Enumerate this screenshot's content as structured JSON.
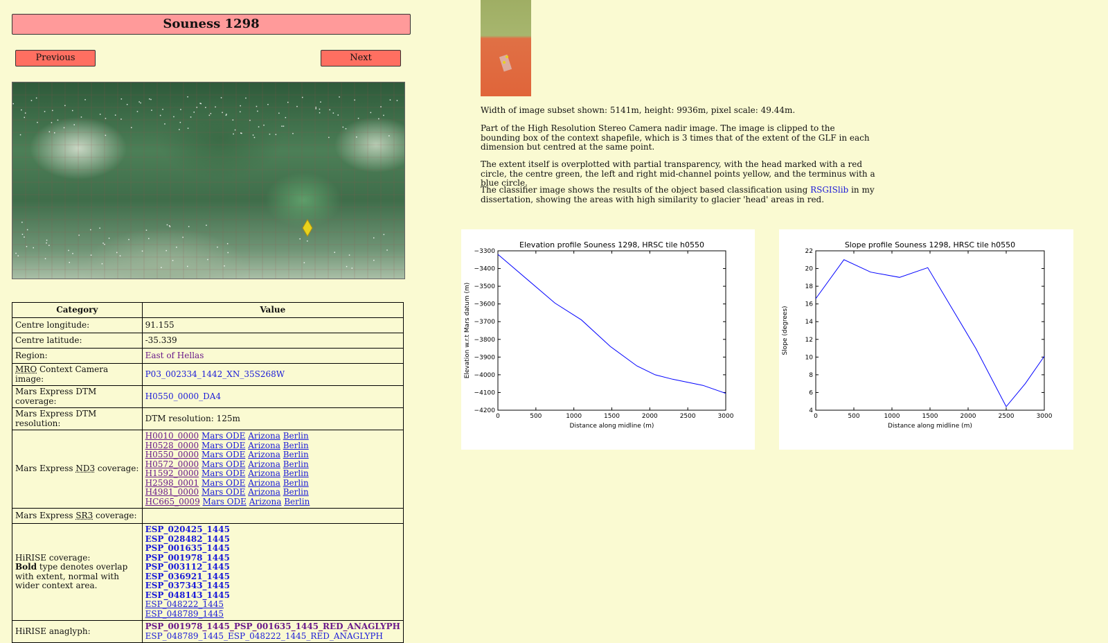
{
  "page": {
    "title": "Souness 1298",
    "previous_label": "Previous",
    "next_label": "Next"
  },
  "description": {
    "p1": "Width of image subset shown: 5141m, height: 9936m, pixel scale: 49.44m.",
    "p2": "Part of the High Resolution Stereo Camera nadir image. The image is clipped to the bounding box of the context shapefile, which is 3 times that of the extent of the GLF in each dimension but centred at the same point.",
    "p3": "The extent itself is overplotted with partial transparency, with the head marked with a red circle, the centre green, the left and right mid-channel points yellow, and the terminus with a blue circle.",
    "p4_before": "The classifier image shows the results of the object based classification using ",
    "p4_link": "RSGISlib",
    "p4_after": " in my dissertation, showing the areas with high similarity to glacier 'head' areas in red."
  },
  "table": {
    "header_category": "Category",
    "header_value": "Value",
    "rows": {
      "centre_longitude": {
        "label": "Centre longitude:",
        "value": "91.155"
      },
      "centre_latitude": {
        "label": "Centre latitude:",
        "value": "-35.339"
      },
      "region": {
        "label": "Region:",
        "value": "East of Hellas"
      },
      "mro_ctx": {
        "abbr": "MRO",
        "label_rest": " Context Camera image:",
        "value": "P03_002334_1442_XN_35S268W"
      },
      "dtm_coverage": {
        "label": "Mars Express DTM coverage:",
        "value": "H0550_0000_DA4"
      },
      "dtm_resolution": {
        "label": "Mars Express DTM resolution:",
        "value": "DTM resolution: 125m"
      },
      "nd3": {
        "label_before": "Mars Express ",
        "abbr": "ND3",
        "label_after": " coverage:",
        "entries": [
          {
            "id": "H0010_0000",
            "l1": "Mars ODE",
            "l2": "Arizona",
            "l3": "Berlin"
          },
          {
            "id": "H0528_0000",
            "l1": "Mars ODE",
            "l2": "Arizona",
            "l3": "Berlin"
          },
          {
            "id": "H0550_0000",
            "l1": "Mars ODE",
            "l2": "Arizona",
            "l3": "Berlin"
          },
          {
            "id": "H0572_0000",
            "l1": "Mars ODE",
            "l2": "Arizona",
            "l3": "Berlin"
          },
          {
            "id": "H1592_0000",
            "l1": "Mars ODE",
            "l2": "Arizona",
            "l3": "Berlin"
          },
          {
            "id": "H2598_0001",
            "l1": "Mars ODE",
            "l2": "Arizona",
            "l3": "Berlin"
          },
          {
            "id": "H4981_0000",
            "l1": "Mars ODE",
            "l2": "Arizona",
            "l3": "Berlin"
          },
          {
            "id": "HC665_0009",
            "l1": "Mars ODE",
            "l2": "Arizona",
            "l3": "Berlin"
          }
        ]
      },
      "sr3": {
        "label_before": "Mars Express ",
        "abbr": "SR3",
        "label_after": " coverage:",
        "value": ""
      },
      "hirise": {
        "label": "HiRISE coverage:",
        "note_bold": "Bold",
        "note_rest": " type denotes overlap with extent, normal with wider context area.",
        "bold_entries": [
          "ESP_020425_1445",
          "ESP_028482_1445",
          "PSP_001635_1445",
          "PSP_001978_1445",
          "PSP_003112_1445",
          "ESP_036921_1445",
          "ESP_037343_1445",
          "ESP_048143_1445"
        ],
        "normal_entries": [
          "ESP_048222_1445",
          "ESP_048789_1445"
        ]
      },
      "anaglyph": {
        "label": "HiRISE anaglyph:",
        "bold": "PSP_001978_1445_PSP_001635_1445_RED_ANAGLYPH",
        "normal": "ESP_048789_1445_ESP_048222_1445_RED_ANAGLYPH"
      }
    }
  },
  "chart_data": [
    {
      "type": "line",
      "title": "Elevation profile Souness 1298, HRSC tile h0550",
      "xlabel": "Distance along midline (m)",
      "ylabel": "Elevation w.r.t Mars datum (m)",
      "xlim": [
        0,
        3000
      ],
      "ylim": [
        -4200,
        -3300
      ],
      "xticks": [
        "0",
        "500",
        "1000",
        "1500",
        "2000",
        "2500",
        "3000"
      ],
      "yticks": [
        "−3300",
        "−3400",
        "−3500",
        "−3600",
        "−3700",
        "−3800",
        "−3900",
        "−4000",
        "−4100",
        "−4200"
      ],
      "x": [
        0,
        750,
        1100,
        1480,
        1830,
        2070,
        2300,
        2700,
        3000
      ],
      "y": [
        -3320,
        -3595,
        -3690,
        -3840,
        -3950,
        -4000,
        -4025,
        -4060,
        -4105
      ],
      "color": "#0000ff"
    },
    {
      "type": "line",
      "title": "Slope profile Souness 1298, HRSC tile h0550",
      "xlabel": "Distance along midline (m)",
      "ylabel": "Slope (degrees)",
      "xlim": [
        0,
        3000
      ],
      "ylim": [
        4,
        22
      ],
      "xticks": [
        "0",
        "500",
        "1000",
        "1500",
        "2000",
        "2500",
        "3000"
      ],
      "yticks": [
        "22",
        "20",
        "18",
        "16",
        "14",
        "12",
        "10",
        "8",
        "6",
        "4"
      ],
      "x": [
        0,
        370,
        720,
        1100,
        1470,
        2100,
        2500,
        2750,
        3000
      ],
      "y": [
        16.6,
        21.0,
        19.6,
        19.0,
        20.1,
        11.0,
        4.4,
        7.0,
        10.1
      ],
      "color": "#0000ff"
    }
  ]
}
